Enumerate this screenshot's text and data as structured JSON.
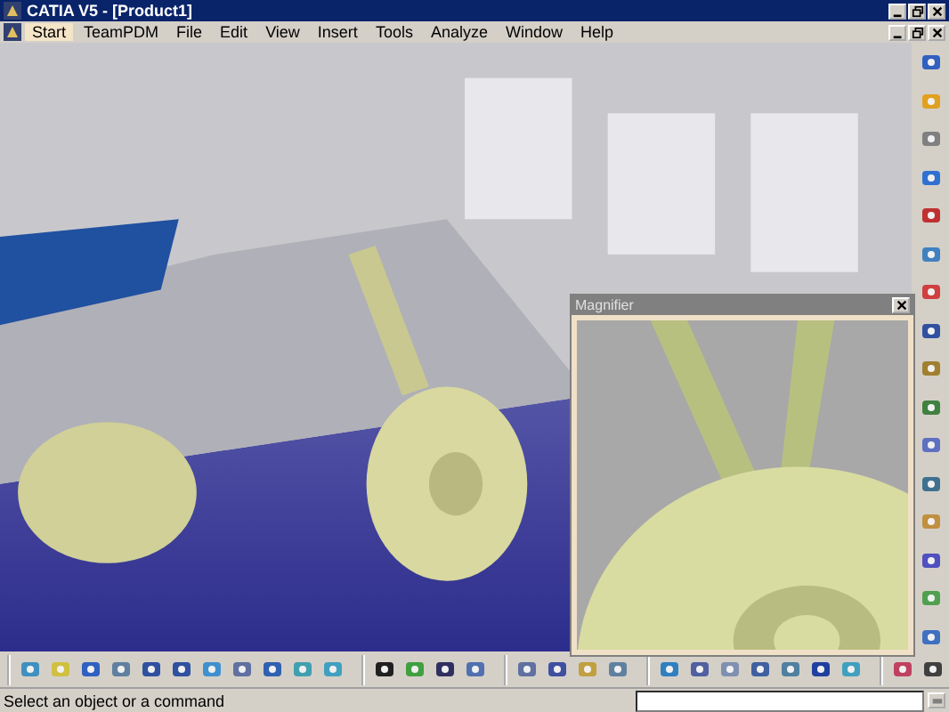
{
  "window": {
    "title": "CATIA V5 - [Product1]"
  },
  "menu": [
    {
      "label": "Start",
      "selected": true
    },
    {
      "label": "TeamPDM",
      "selected": false
    },
    {
      "label": "File",
      "selected": false
    },
    {
      "label": "Edit",
      "selected": false
    },
    {
      "label": "View",
      "selected": false
    },
    {
      "label": "Insert",
      "selected": false
    },
    {
      "label": "Tools",
      "selected": false
    },
    {
      "label": "Analyze",
      "selected": false
    },
    {
      "label": "Window",
      "selected": false
    },
    {
      "label": "Help",
      "selected": false
    }
  ],
  "magnifier": {
    "title": "Magnifier"
  },
  "status_bar": {
    "message": "Select an object or a command"
  }
}
